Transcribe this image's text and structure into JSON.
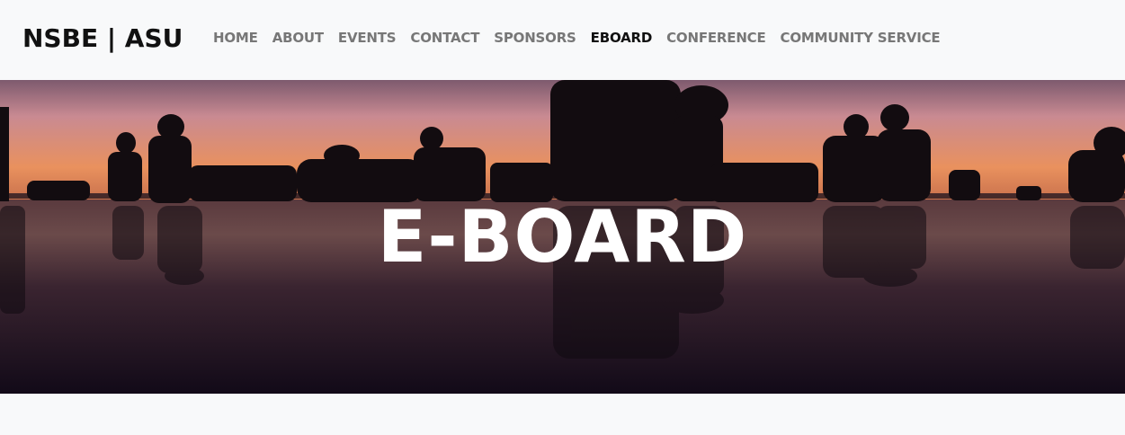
{
  "brand": {
    "title": "NSBE | ASU"
  },
  "nav": {
    "items": [
      {
        "label": "HOME",
        "active": false
      },
      {
        "label": "ABOUT",
        "active": false
      },
      {
        "label": "EVENTS",
        "active": false
      },
      {
        "label": "CONTACT",
        "active": false
      },
      {
        "label": "SPONSORS",
        "active": false
      },
      {
        "label": "EBOARD",
        "active": true
      },
      {
        "label": "CONFERENCE",
        "active": false
      },
      {
        "label": "COMMUNITY SERVICE",
        "active": false
      }
    ]
  },
  "hero": {
    "title": "E-BOARD",
    "image": "silhouettes-of-people-at-sunset-reflected-on-water"
  },
  "colors": {
    "navbar_bg": "#f8f9fa",
    "brand_text": "#111111",
    "nav_text": "#777777",
    "nav_active": "#111111",
    "hero_title": "#ffffff",
    "sunset_top": "#c98a92",
    "sunset_horizon": "#e9915e"
  }
}
